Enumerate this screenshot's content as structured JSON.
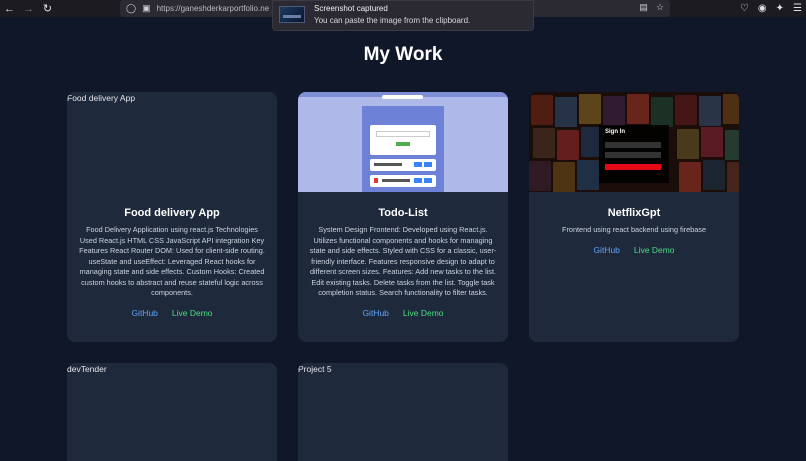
{
  "browser": {
    "url": "https://ganeshderkarportfolio.ne",
    "back_icon": "arrow-left-icon",
    "forward_icon": "arrow-right-icon",
    "reload_icon": "reload-icon"
  },
  "notification": {
    "title": "Screenshot captured",
    "message": "You can paste the image from the clipboard."
  },
  "page": {
    "title": "My Work"
  },
  "projects": [
    {
      "top_label": "Food delivery App",
      "title": "Food delivery App",
      "description": "Food Delivery Application using react.js Technologies Used React.js HTML CSS JavaScript API integration Key Features React Router DOM: Used for client-side routing. useState and useEffect: Leveraged React hooks for managing state and side effects. Custom Hooks: Created custom hooks to abstract and reuse stateful logic across components.",
      "github": "GitHub",
      "live": "Live Demo"
    },
    {
      "top_label": "",
      "title": "Todo-List",
      "description": "System Design Frontend: Developed using React.js. Utilizes functional components and hooks for managing state and side effects. Styled with CSS for a classic, user-friendly interface. Features responsive design to adapt to different screen sizes. Features: Add new tasks to the list. Edit existing tasks. Delete tasks from the list. Toggle task completion status. Search functionality to filter tasks.",
      "github": "GitHub",
      "live": "Live Demo"
    },
    {
      "top_label": "",
      "title": "NetflixGpt",
      "description": "Frontend using react backend using firebase",
      "github": "GitHub",
      "live": "Live Demo",
      "signin_label": "Sign In"
    },
    {
      "top_label": "devTender"
    },
    {
      "top_label": "Project 5"
    }
  ],
  "colors": {
    "background": "#0f1729",
    "card": "#1e293b",
    "github_link": "#60a5fa",
    "live_link": "#4ade80"
  }
}
